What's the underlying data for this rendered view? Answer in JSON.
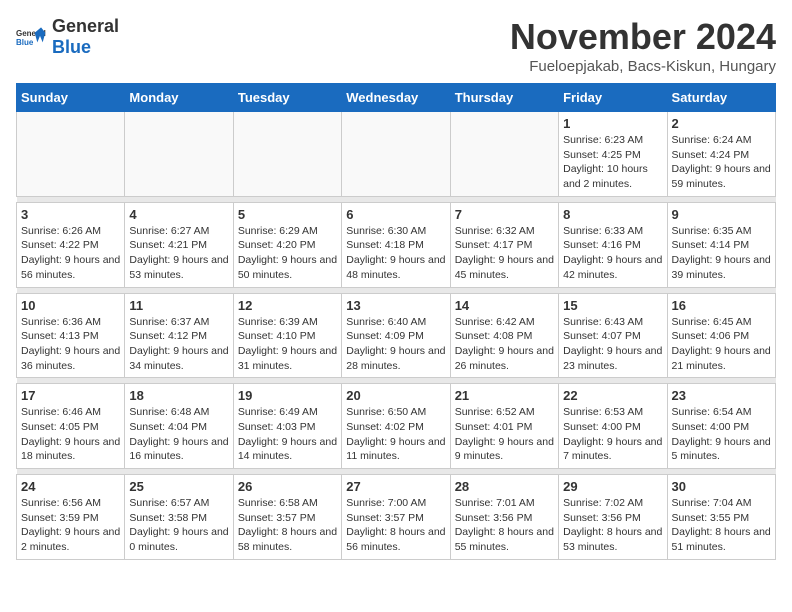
{
  "header": {
    "logo_general": "General",
    "logo_blue": "Blue",
    "month_title": "November 2024",
    "location": "Fueloepjakab, Bacs-Kiskun, Hungary"
  },
  "days_of_week": [
    "Sunday",
    "Monday",
    "Tuesday",
    "Wednesday",
    "Thursday",
    "Friday",
    "Saturday"
  ],
  "weeks": [
    [
      {
        "day": "",
        "info": ""
      },
      {
        "day": "",
        "info": ""
      },
      {
        "day": "",
        "info": ""
      },
      {
        "day": "",
        "info": ""
      },
      {
        "day": "",
        "info": ""
      },
      {
        "day": "1",
        "info": "Sunrise: 6:23 AM\nSunset: 4:25 PM\nDaylight: 10 hours and 2 minutes."
      },
      {
        "day": "2",
        "info": "Sunrise: 6:24 AM\nSunset: 4:24 PM\nDaylight: 9 hours and 59 minutes."
      }
    ],
    [
      {
        "day": "3",
        "info": "Sunrise: 6:26 AM\nSunset: 4:22 PM\nDaylight: 9 hours and 56 minutes."
      },
      {
        "day": "4",
        "info": "Sunrise: 6:27 AM\nSunset: 4:21 PM\nDaylight: 9 hours and 53 minutes."
      },
      {
        "day": "5",
        "info": "Sunrise: 6:29 AM\nSunset: 4:20 PM\nDaylight: 9 hours and 50 minutes."
      },
      {
        "day": "6",
        "info": "Sunrise: 6:30 AM\nSunset: 4:18 PM\nDaylight: 9 hours and 48 minutes."
      },
      {
        "day": "7",
        "info": "Sunrise: 6:32 AM\nSunset: 4:17 PM\nDaylight: 9 hours and 45 minutes."
      },
      {
        "day": "8",
        "info": "Sunrise: 6:33 AM\nSunset: 4:16 PM\nDaylight: 9 hours and 42 minutes."
      },
      {
        "day": "9",
        "info": "Sunrise: 6:35 AM\nSunset: 4:14 PM\nDaylight: 9 hours and 39 minutes."
      }
    ],
    [
      {
        "day": "10",
        "info": "Sunrise: 6:36 AM\nSunset: 4:13 PM\nDaylight: 9 hours and 36 minutes."
      },
      {
        "day": "11",
        "info": "Sunrise: 6:37 AM\nSunset: 4:12 PM\nDaylight: 9 hours and 34 minutes."
      },
      {
        "day": "12",
        "info": "Sunrise: 6:39 AM\nSunset: 4:10 PM\nDaylight: 9 hours and 31 minutes."
      },
      {
        "day": "13",
        "info": "Sunrise: 6:40 AM\nSunset: 4:09 PM\nDaylight: 9 hours and 28 minutes."
      },
      {
        "day": "14",
        "info": "Sunrise: 6:42 AM\nSunset: 4:08 PM\nDaylight: 9 hours and 26 minutes."
      },
      {
        "day": "15",
        "info": "Sunrise: 6:43 AM\nSunset: 4:07 PM\nDaylight: 9 hours and 23 minutes."
      },
      {
        "day": "16",
        "info": "Sunrise: 6:45 AM\nSunset: 4:06 PM\nDaylight: 9 hours and 21 minutes."
      }
    ],
    [
      {
        "day": "17",
        "info": "Sunrise: 6:46 AM\nSunset: 4:05 PM\nDaylight: 9 hours and 18 minutes."
      },
      {
        "day": "18",
        "info": "Sunrise: 6:48 AM\nSunset: 4:04 PM\nDaylight: 9 hours and 16 minutes."
      },
      {
        "day": "19",
        "info": "Sunrise: 6:49 AM\nSunset: 4:03 PM\nDaylight: 9 hours and 14 minutes."
      },
      {
        "day": "20",
        "info": "Sunrise: 6:50 AM\nSunset: 4:02 PM\nDaylight: 9 hours and 11 minutes."
      },
      {
        "day": "21",
        "info": "Sunrise: 6:52 AM\nSunset: 4:01 PM\nDaylight: 9 hours and 9 minutes."
      },
      {
        "day": "22",
        "info": "Sunrise: 6:53 AM\nSunset: 4:00 PM\nDaylight: 9 hours and 7 minutes."
      },
      {
        "day": "23",
        "info": "Sunrise: 6:54 AM\nSunset: 4:00 PM\nDaylight: 9 hours and 5 minutes."
      }
    ],
    [
      {
        "day": "24",
        "info": "Sunrise: 6:56 AM\nSunset: 3:59 PM\nDaylight: 9 hours and 2 minutes."
      },
      {
        "day": "25",
        "info": "Sunrise: 6:57 AM\nSunset: 3:58 PM\nDaylight: 9 hours and 0 minutes."
      },
      {
        "day": "26",
        "info": "Sunrise: 6:58 AM\nSunset: 3:57 PM\nDaylight: 8 hours and 58 minutes."
      },
      {
        "day": "27",
        "info": "Sunrise: 7:00 AM\nSunset: 3:57 PM\nDaylight: 8 hours and 56 minutes."
      },
      {
        "day": "28",
        "info": "Sunrise: 7:01 AM\nSunset: 3:56 PM\nDaylight: 8 hours and 55 minutes."
      },
      {
        "day": "29",
        "info": "Sunrise: 7:02 AM\nSunset: 3:56 PM\nDaylight: 8 hours and 53 minutes."
      },
      {
        "day": "30",
        "info": "Sunrise: 7:04 AM\nSunset: 3:55 PM\nDaylight: 8 hours and 51 minutes."
      }
    ]
  ]
}
